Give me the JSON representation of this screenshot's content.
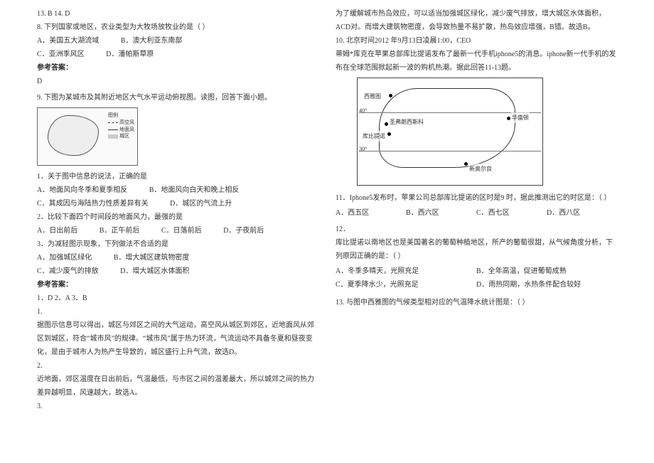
{
  "left": {
    "line_top": "13. B   14. D",
    "q8": {
      "stem": "8. 下列国家或地区，农业类型为大牧场放牧业的是（    ）",
      "A": "A．美国五大湖流域",
      "B": "B．澳大利亚东南部",
      "C": "C．亚洲季风区",
      "D": "D．潘帕斯草原",
      "ans_label": "参考答案：",
      "ans": "D"
    },
    "q9": {
      "stem": "9. 下图为某城市及其附近地区大气水平运动俯视图。读图，回答下面小题。",
      "legend_title": "图例",
      "legend_a": "高空风",
      "legend_b": "地面风",
      "legend_c": "城区",
      "sub1": "1．关于图中信息的说法，正确的是",
      "sub1A": "A．地面风向冬季和夏季相反",
      "sub1B": "B．地面风向白天和晚上相反",
      "sub1C": "C．其成因与海陆热力性质差异有关",
      "sub1D": "D．城区的气流上升",
      "sub2": "2．比较下面四个时间段的地面风力，最强的是",
      "sub2A": "A．日出前后",
      "sub2B": "B．正午前后",
      "sub2C": "C．日落前后",
      "sub2D": "D．子夜前后",
      "sub3": "3．为减轻图示现象，下列做法不合适的是",
      "sub3A": "A．加强城区绿化",
      "sub3B": "B．增大城区建筑物密度",
      "sub3C": "C．减少废气的排放",
      "sub3D": "D．增大城区水体面积",
      "ans_label": "参考答案：",
      "ans_line": "1．D   2．A   3．B",
      "exp1_label": "1.",
      "exp1": "据图示信息可以得出，城区与郊区之间的大气运动，高空风从城区到郊区，近地面风从郊区到城区，符合“城市风”的规律。“城市风”属于热力环流，气流运动不具备冬夏和昼夜变化，是由于城市人为热产生导致的，城区盛行上升气流，故选D。",
      "exp2_label": "2.",
      "exp2": "近地面，郊区温度在日出前后，气温最低，与市区之间的温差最大，所以城郊之间的热力差异越明显，风速越大，故选A。",
      "exp3_label": "3."
    }
  },
  "right": {
    "exp3_cont": "为了缓解城市热岛效应，可以适当加强城区绿化，减少废气排放，增大城区水体面积，ACD对。而增大建筑物密度，会导致热量不易扩散，热岛效应增强，B错。故选B。",
    "q10": {
      "line1": "10. 北京时间2012 年9月13日凌晨1:00，CEO",
      "line2": "蒂姆*库克在苹果总部库比提诺发布了最新一代手机iphone5的消息。iphone新一代手机的发布在全球范围掀起新一波的购机热潮。据此回答11-13题。",
      "map": {
        "seattle": "西雅图",
        "sf": "圣弗朗西斯科",
        "cupertino": "库比提诺",
        "washington": "华盛顿",
        "neworleans": "新奥尔良",
        "lat40": "40°",
        "lat30": "30°"
      }
    },
    "q11": {
      "stem": "11．Iphone5发布时，苹果公司总部库比提诺的区时是9 时，据此推测出它的时区是：（    ）",
      "A": "A．西五区",
      "B": "B．西六区",
      "C": "C．西七区",
      "D": "D．西八区"
    },
    "q12": {
      "num": "12．",
      "stem": "库比提诺以南地区也是美国著名的葡萄种植地区，所产的葡萄很甜，从气候角度分析，下列原因正确的是：（    ）",
      "A": "A．冬季多晴天，光照充足",
      "B": "B．全年高温，促进葡萄成熟",
      "C": "C．夏季降水少，光照充足",
      "D": "D．雨热同期，水热条件配合较好"
    },
    "q13": {
      "stem": "13. 与图中西雅图的气候类型相对应的气温降水统计图是：（    ）"
    }
  }
}
